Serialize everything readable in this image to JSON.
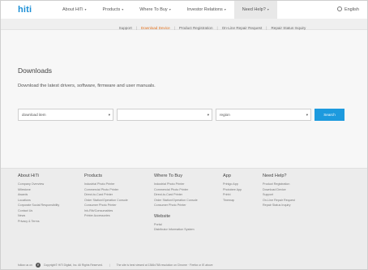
{
  "brand": {
    "logo": "hiti"
  },
  "nav": {
    "items": [
      {
        "label": "About HiTi",
        "caret": true
      },
      {
        "label": "Products",
        "caret": true
      },
      {
        "label": "Where To Buy",
        "caret": true
      },
      {
        "label": "Investor Relations",
        "caret": true
      },
      {
        "label": "Need Help?",
        "caret": true,
        "active": true
      }
    ],
    "language": "English"
  },
  "subnav": {
    "items": [
      "Support",
      "Download Device",
      "Product Registration",
      "On-Line Repair Request",
      "Repair Status Inquiry"
    ],
    "current_index": 1
  },
  "main": {
    "title": "Downloads",
    "description": "Download the latest drivers, software, firmware and user manuals.",
    "select_item": "download item",
    "select_model": "",
    "select_region": "region",
    "search_label": "Search"
  },
  "footer": {
    "about": {
      "title": "About HiTi",
      "links": [
        "Company Overview",
        "Milestone",
        "Awards",
        "Locations",
        "Corporate Social Responsibility",
        "Contact Us",
        "News",
        "Privacy & Terms"
      ]
    },
    "products": {
      "title": "Products",
      "links": [
        "Industrial Photo Printer",
        "Commercial Photo Printer",
        "Direct-to-Card Printer",
        "Order Station/Operation Console",
        "Consumer Photo Printer",
        "Ink-Rib/Consumables",
        "Printer Accessories"
      ]
    },
    "where": {
      "title": "Where To Buy",
      "links": [
        "Industrial Photo Printer",
        "Commercial Photo Printer",
        "Direct-to-Card Printer",
        "Order Station/Operation Console",
        "Consumer Photo Printer"
      ]
    },
    "website": {
      "title": "Website",
      "links": [
        "Portal",
        "Distributor Information System"
      ]
    },
    "app": {
      "title": "App",
      "links": [
        "Prinigo App",
        "Photobee App",
        "Prinhi",
        "Tinemap"
      ]
    },
    "help": {
      "title": "Need Help?",
      "links": [
        "Product Registration",
        "Download Device",
        "Support",
        "On-Line Repair Request",
        "Repair Status Inquiry"
      ]
    },
    "follow": "follow us on",
    "copyright": "Copyright© HiTi Digital, Inc. All Rights Reserved.",
    "notice": "The site is best viewed at 1366x768 resolution on Chrome · Firefox or IE above"
  }
}
